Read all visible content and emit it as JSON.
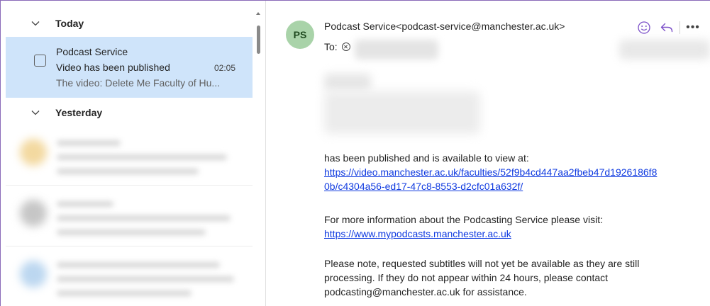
{
  "message_list": {
    "groups": [
      {
        "label": "Today"
      },
      {
        "label": "Yesterday"
      }
    ],
    "selected_message": {
      "sender": "Podcast Service",
      "subject": "Video has been published",
      "time": "02:05",
      "preview": "The video: Delete Me Faculty of Hu..."
    }
  },
  "reading_pane": {
    "avatar_initials": "PS",
    "from": "Podcast Service<podcast-service@manchester.ac.uk>",
    "to_label": "To:",
    "body": {
      "published_line": "has been published and is available to view at:",
      "video_link_line1": "https://video.manchester.ac.uk/faculties/52f9b4cd447aa2fbeb47d1926186f8",
      "video_link_line2": "0b/c4304a56-ed17-47c8-8553-d2cfc01a632f/",
      "info_line": "For more information about the Podcasting Service please visit:",
      "info_link": "https://www.mypodcasts.manchester.ac.uk",
      "note_line1": "Please note, requested subtitles will not yet be available as they are still",
      "note_line2": "processing. If they do not appear within 24 hours, please contact",
      "note_line3": "podcasting@manchester.ac.uk for assistance."
    }
  },
  "icons": {
    "collapse_chevron": "chevron-down-icon",
    "remove_recipient": "close-circle-icon",
    "emoji": "smiley-icon",
    "reply": "reply-icon",
    "more": "more-horizontal-icon"
  },
  "colors": {
    "selected_row": "#cfe4fa",
    "avatar_bg": "#a9d3a9",
    "link": "#0f3ae0",
    "accent_icon": "#7b4fc8"
  }
}
